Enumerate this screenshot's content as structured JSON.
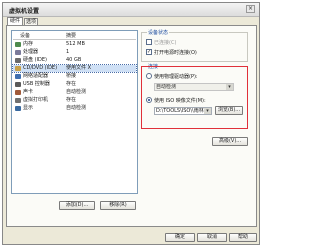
{
  "window": {
    "title": "虚拟机设置",
    "close": "×"
  },
  "tabs": [
    "硬件",
    "选项"
  ],
  "device_list": {
    "headers": {
      "device": "设备",
      "summary": "摘要"
    },
    "rows": [
      {
        "name": "内存",
        "summary": "512 MB",
        "icon": "memory-icon",
        "color": "#4d8a4d"
      },
      {
        "name": "处理器",
        "summary": "1",
        "icon": "cpu-icon",
        "color": "#7a7a9a"
      },
      {
        "name": "硬盘 (IDE)",
        "summary": "40 GB",
        "icon": "hard-disk-icon",
        "color": "#6b6b6b"
      },
      {
        "name": "CD/DVD (IDE)",
        "summary": "使用文件 X",
        "icon": "cd-dvd-icon",
        "color": "#c9a24a"
      },
      {
        "name": "网络适配器",
        "summary": "桥接",
        "icon": "network-icon",
        "color": "#3f6fb0"
      },
      {
        "name": "USB 控制器",
        "summary": "存在",
        "icon": "usb-icon",
        "color": "#5a5a5a"
      },
      {
        "name": "声卡",
        "summary": "自动检测",
        "icon": "sound-icon",
        "color": "#a05a3a"
      },
      {
        "name": "虚拟打印机",
        "summary": "存在",
        "icon": "printer-icon",
        "color": "#707070"
      },
      {
        "name": "显示",
        "summary": "自动检测",
        "icon": "display-icon",
        "color": "#3a6aa0"
      }
    ],
    "selected_index": 3
  },
  "buttons": {
    "add": "添加(D)...",
    "remove": "移除(R)",
    "advanced": "高级(V)...",
    "browse": "浏览(B)...",
    "ok": "确定",
    "cancel": "取消",
    "help": "帮助"
  },
  "device_status": {
    "title": "设备状态",
    "connected": "已连接(C)",
    "connect_on_power": "打开电源时连接(O)",
    "connect_on_power_checked": true
  },
  "connection": {
    "title": "连接",
    "physical": "使用物理驱动器(P):",
    "physical_value": "自动检测",
    "iso": "使用 ISO 映像文件(M):",
    "iso_path": "D:\\TOOLS\\ISO\\\\雨林木",
    "selected": "iso"
  }
}
